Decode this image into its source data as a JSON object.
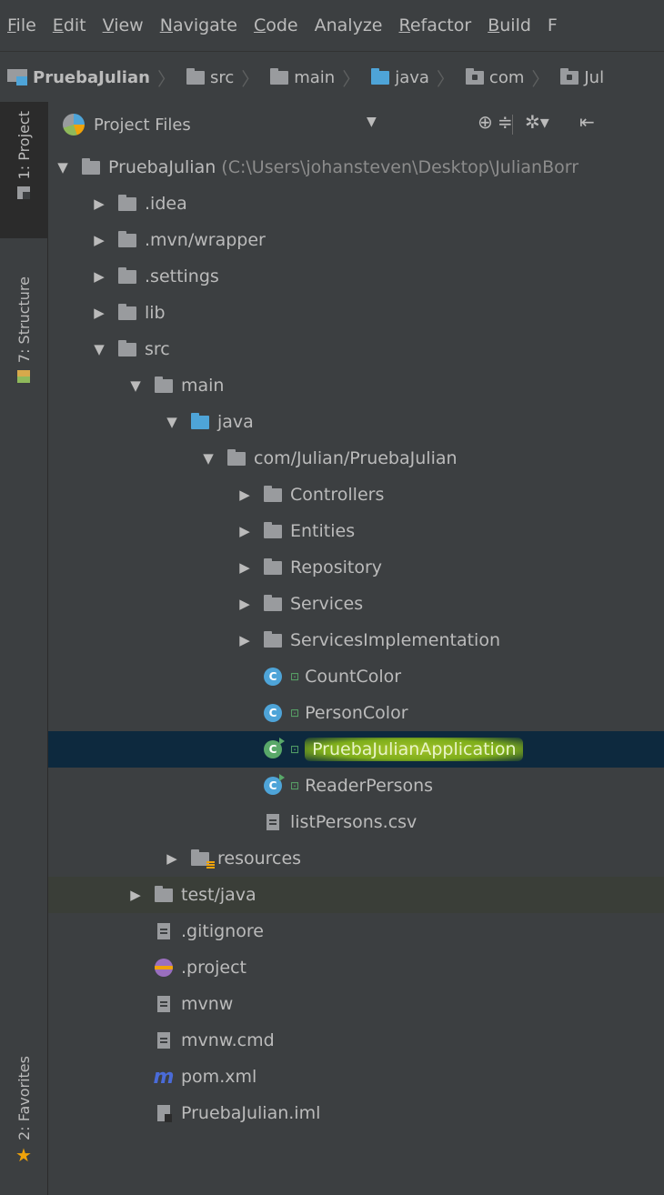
{
  "menu": [
    {
      "mnemonic": "F",
      "rest": "ile"
    },
    {
      "mnemonic": "E",
      "rest": "dit"
    },
    {
      "mnemonic": "V",
      "rest": "iew"
    },
    {
      "mnemonic": "N",
      "rest": "avigate"
    },
    {
      "mnemonic": "C",
      "rest": "ode"
    },
    {
      "mnemonic": "",
      "rest": "Analyze"
    },
    {
      "mnemonic": "R",
      "rest": "efactor"
    },
    {
      "mnemonic": "B",
      "rest": "uild"
    },
    {
      "mnemonic": "",
      "rest": "F"
    }
  ],
  "breadcrumb": [
    "PruebaJulian",
    "src",
    "main",
    "java",
    "com",
    "Jul"
  ],
  "side_tabs": {
    "project": "1: Project",
    "structure": "7: Structure",
    "favorites": "2: Favorites"
  },
  "panel": {
    "title": "Project Files"
  },
  "tree": [
    {
      "label": "PruebaJulian",
      "path": "(C:\\Users\\johansteven\\Desktop\\JulianBorr",
      "icon": "folder-icon",
      "arrow": "▼",
      "depth": 0
    },
    {
      "label": ".idea",
      "icon": "folder-icon",
      "arrow": "▶",
      "depth": 1
    },
    {
      "label": ".mvn/wrapper",
      "icon": "folder-icon",
      "arrow": "▶",
      "depth": 1
    },
    {
      "label": ".settings",
      "icon": "folder-icon",
      "arrow": "▶",
      "depth": 1
    },
    {
      "label": "lib",
      "icon": "folder-icon",
      "arrow": "▶",
      "depth": 1
    },
    {
      "label": "src",
      "icon": "folder-icon",
      "arrow": "▼",
      "depth": 1
    },
    {
      "label": "main",
      "icon": "folder-icon",
      "arrow": "▼",
      "depth": 2
    },
    {
      "label": "java",
      "icon": "source-folder-icon",
      "arrow": "▼",
      "depth": 3
    },
    {
      "label": "com/Julian/PruebaJulian",
      "icon": "package-icon",
      "arrow": "▼",
      "depth": 4
    },
    {
      "label": "Controllers",
      "icon": "package-icon",
      "arrow": "▶",
      "depth": 5
    },
    {
      "label": "Entities",
      "icon": "package-icon",
      "arrow": "▶",
      "depth": 5
    },
    {
      "label": "Repository",
      "icon": "package-icon",
      "arrow": "▶",
      "depth": 5
    },
    {
      "label": "Services",
      "icon": "package-icon",
      "arrow": "▶",
      "depth": 5
    },
    {
      "label": "ServicesImplementation",
      "icon": "package-icon",
      "arrow": "▶",
      "depth": 5
    },
    {
      "label": "CountColor",
      "icon": "class-icon",
      "arrow": "",
      "depth": 5
    },
    {
      "label": "PersonColor",
      "icon": "class-icon",
      "arrow": "",
      "depth": 5
    },
    {
      "label": "PruebaJulianApplication",
      "icon": "runnable-class-icon",
      "arrow": "",
      "depth": 5,
      "selected": true
    },
    {
      "label": "ReaderPersons",
      "icon": "runnable-class-icon",
      "arrow": "",
      "depth": 5
    },
    {
      "label": "listPersons.csv",
      "icon": "text-file-icon",
      "arrow": "",
      "depth": 5
    },
    {
      "label": "resources",
      "icon": "resources-folder-icon",
      "arrow": "▶",
      "depth": 3
    },
    {
      "label": "test/java",
      "icon": "folder-icon",
      "arrow": "▶",
      "depth": 2
    },
    {
      "label": ".gitignore",
      "icon": "text-file-icon",
      "arrow": "",
      "depth": 2
    },
    {
      "label": ".project",
      "icon": "eclipse-project-icon",
      "arrow": "",
      "depth": 2
    },
    {
      "label": "mvnw",
      "icon": "text-file-icon",
      "arrow": "",
      "depth": 2
    },
    {
      "label": "mvnw.cmd",
      "icon": "text-file-icon",
      "arrow": "",
      "depth": 2
    },
    {
      "label": "pom.xml",
      "icon": "maven-icon",
      "arrow": "",
      "depth": 2
    },
    {
      "label": "PruebaJulian.iml",
      "icon": "module-file-icon",
      "arrow": "",
      "depth": 2
    }
  ],
  "colors": {
    "background": "#3c3f41",
    "selection": "#0d293e",
    "highlight": "#a2c22a",
    "folder": "#999b9e",
    "source_folder": "#4ea4d8"
  }
}
